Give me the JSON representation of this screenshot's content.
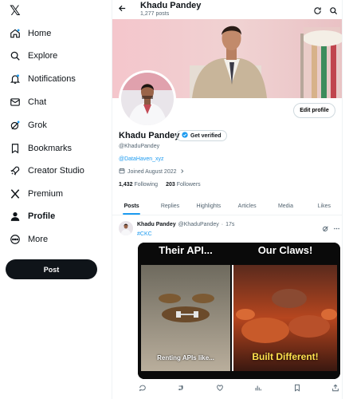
{
  "nav": {
    "logo": "𝕏",
    "items": [
      {
        "label": "Home"
      },
      {
        "label": "Explore"
      },
      {
        "label": "Notifications"
      },
      {
        "label": "Chat"
      },
      {
        "label": "Grok"
      },
      {
        "label": "Bookmarks"
      },
      {
        "label": "Creator Studio"
      },
      {
        "label": "Premium"
      },
      {
        "label": "Profile"
      },
      {
        "label": "More"
      }
    ],
    "post_label": "Post"
  },
  "header": {
    "name": "Khadu Pandey",
    "post_count": "1,277 posts"
  },
  "profile": {
    "name": "Khadu Pandey",
    "get_verified": "Get verified",
    "handle": "@KhaduPandey",
    "link": "@DataHaven_xyz",
    "joined": "Joined August 2022",
    "following_count": "1,432",
    "following_label": "Following",
    "followers_count": "203",
    "followers_label": "Followers",
    "edit_label": "Edit profile"
  },
  "tabs": [
    {
      "label": "Posts"
    },
    {
      "label": "Replies"
    },
    {
      "label": "Highlights"
    },
    {
      "label": "Articles"
    },
    {
      "label": "Media"
    },
    {
      "label": "Likes"
    }
  ],
  "post": {
    "author": "Khadu Pandey",
    "handle": "@KhaduPandey",
    "separator": "·",
    "time": "17s",
    "tag": "#CKC",
    "meme": {
      "left_title": "Their API...",
      "right_title": "Our Claws!",
      "left_caption": "Renting APIs like...",
      "right_caption": "Built Different!"
    }
  },
  "colors": {
    "accent": "#1d9bf0",
    "text": "#0f1419",
    "muted": "#536471",
    "verified_badge": "#1d9bf0",
    "meme_title": "#ffe14d"
  }
}
